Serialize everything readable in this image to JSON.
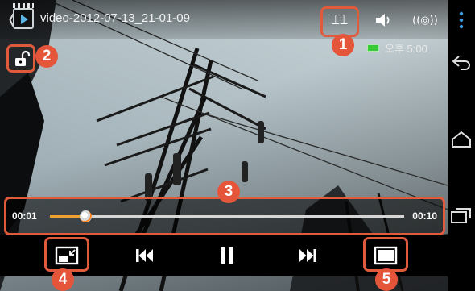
{
  "video": {
    "title": "video-2012-07-13_21-01-09"
  },
  "topbar": {
    "icons": [
      "back-arrow-icon",
      "video-player-app-icon",
      "split-screen-icon",
      "volume-icon",
      "wireless-share-icon"
    ],
    "split_glyph": "⌶⌶",
    "wireless_glyph": "((◎))"
  },
  "status": {
    "battery_icon": "battery-icon",
    "time": "오후 5:00"
  },
  "lock": {
    "icon": "unlock-icon"
  },
  "seekbar": {
    "current": "00:01",
    "total": "00:10",
    "progress": 0.1
  },
  "controls": {
    "buttons": [
      "pop-up-player-icon",
      "previous-icon",
      "pause-icon",
      "next-icon",
      "screen-size-icon"
    ]
  },
  "navbar": {
    "buttons": [
      "menu-icon",
      "back-icon",
      "home-icon",
      "recent-apps-icon"
    ]
  },
  "callouts": [
    "1",
    "2",
    "3",
    "4",
    "5"
  ],
  "colors": {
    "callout": "#e4553a",
    "seek_fill": "#f0a030",
    "battery": "#38c838",
    "menu_dots": "#3aa0e8"
  }
}
